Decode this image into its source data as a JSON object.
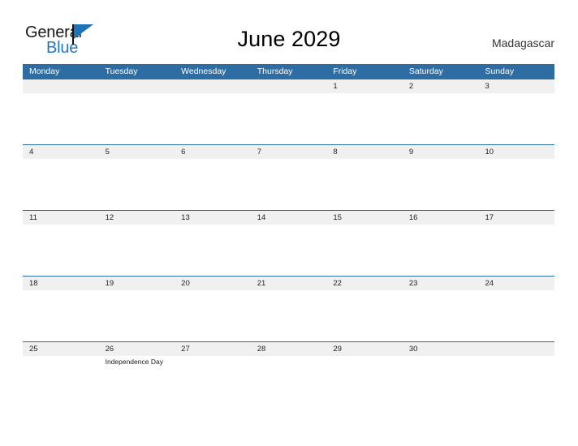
{
  "brand": {
    "name_line1": "General",
    "name_line2": "Blue",
    "flag_icon": "blue-triangle-flag",
    "primary_color": "#1d72b8",
    "secondary_color": "#2277c8"
  },
  "header": {
    "title": "June 2029",
    "country": "Madagascar"
  },
  "calendar": {
    "header_color": "#2e6da4",
    "band_color": "#f0f0f0",
    "day_names": [
      "Monday",
      "Tuesday",
      "Wednesday",
      "Thursday",
      "Friday",
      "Saturday",
      "Sunday"
    ],
    "weeks": [
      {
        "days": [
          {
            "number": "",
            "event": ""
          },
          {
            "number": "",
            "event": ""
          },
          {
            "number": "",
            "event": ""
          },
          {
            "number": "",
            "event": ""
          },
          {
            "number": "1",
            "event": ""
          },
          {
            "number": "2",
            "event": ""
          },
          {
            "number": "3",
            "event": ""
          }
        ]
      },
      {
        "days": [
          {
            "number": "4",
            "event": ""
          },
          {
            "number": "5",
            "event": ""
          },
          {
            "number": "6",
            "event": ""
          },
          {
            "number": "7",
            "event": ""
          },
          {
            "number": "8",
            "event": ""
          },
          {
            "number": "9",
            "event": ""
          },
          {
            "number": "10",
            "event": ""
          }
        ]
      },
      {
        "days": [
          {
            "number": "11",
            "event": ""
          },
          {
            "number": "12",
            "event": ""
          },
          {
            "number": "13",
            "event": ""
          },
          {
            "number": "14",
            "event": ""
          },
          {
            "number": "15",
            "event": ""
          },
          {
            "number": "16",
            "event": ""
          },
          {
            "number": "17",
            "event": ""
          }
        ]
      },
      {
        "days": [
          {
            "number": "18",
            "event": ""
          },
          {
            "number": "19",
            "event": ""
          },
          {
            "number": "20",
            "event": ""
          },
          {
            "number": "21",
            "event": ""
          },
          {
            "number": "22",
            "event": ""
          },
          {
            "number": "23",
            "event": ""
          },
          {
            "number": "24",
            "event": ""
          }
        ]
      },
      {
        "days": [
          {
            "number": "25",
            "event": ""
          },
          {
            "number": "26",
            "event": "Independence Day"
          },
          {
            "number": "27",
            "event": ""
          },
          {
            "number": "28",
            "event": ""
          },
          {
            "number": "29",
            "event": ""
          },
          {
            "number": "30",
            "event": ""
          },
          {
            "number": "",
            "event": ""
          }
        ]
      }
    ]
  }
}
